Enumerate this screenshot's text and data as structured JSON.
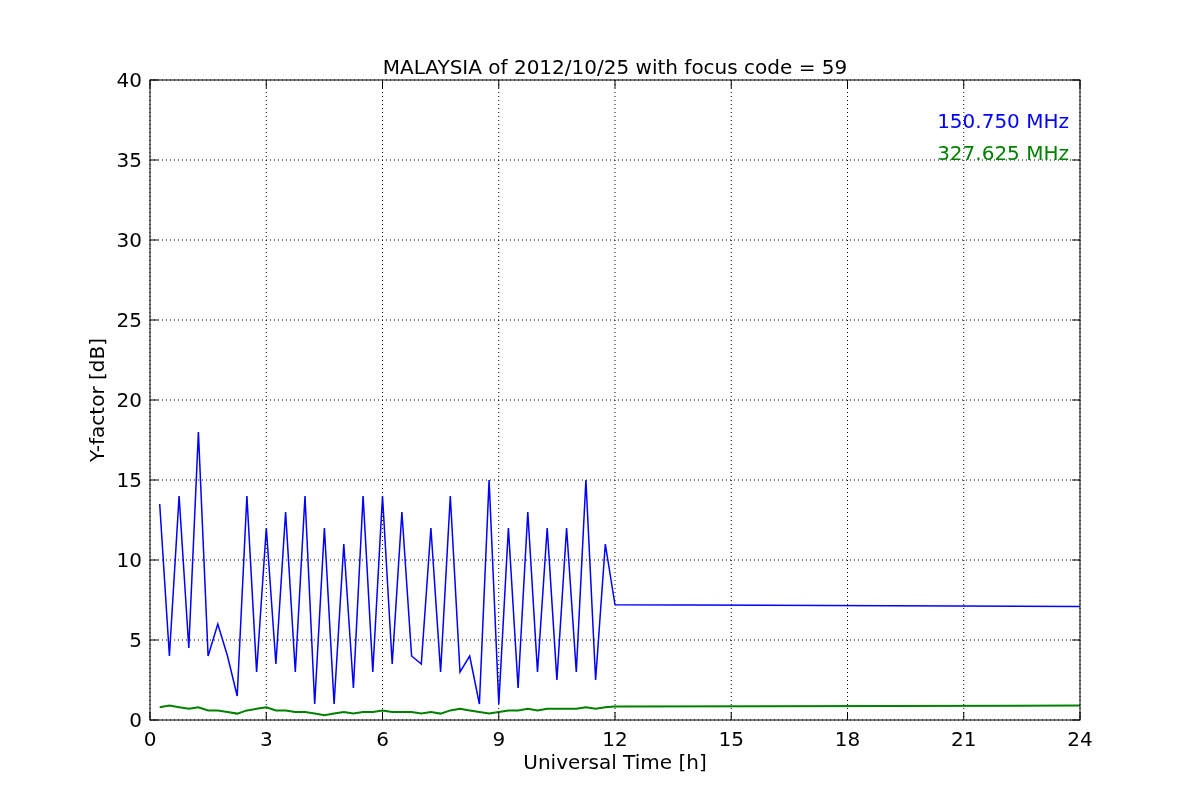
{
  "chart_data": {
    "type": "line",
    "title": "MALAYSIA of 2012/10/25 with focus code = 59",
    "xlabel": "Universal Time [h]",
    "ylabel": "Y-factor [dB]",
    "x": [
      0.25,
      0.5,
      0.75,
      1.0,
      1.25,
      1.5,
      1.75,
      2.0,
      2.25,
      2.5,
      2.75,
      3.0,
      3.25,
      3.5,
      3.75,
      4.0,
      4.25,
      4.5,
      4.75,
      5.0,
      5.25,
      5.5,
      5.75,
      6.0,
      6.25,
      6.5,
      6.75,
      7.0,
      7.25,
      7.5,
      7.75,
      8.0,
      8.25,
      8.5,
      8.75,
      9.0,
      9.25,
      9.5,
      9.75,
      10.0,
      10.25,
      10.5,
      10.75,
      11.0,
      11.25,
      11.5,
      11.75,
      12.0,
      24.0
    ],
    "series": [
      {
        "name": "150.750 MHz",
        "color": "#0000ff",
        "values": [
          13.5,
          4,
          14,
          4.5,
          18,
          4,
          6,
          4,
          1.5,
          14,
          3,
          12,
          3.5,
          13,
          3,
          14,
          1,
          12,
          1,
          11,
          2,
          14,
          3,
          14,
          3.5,
          13,
          4,
          3.5,
          12,
          3,
          14,
          3,
          4,
          1,
          15,
          1,
          12,
          2,
          13,
          3,
          12,
          2.5,
          12,
          3,
          15,
          2.5,
          11,
          7.2,
          7.1
        ]
      },
      {
        "name": "327.625 MHz",
        "color": "#008000",
        "values": [
          0.8,
          0.9,
          0.8,
          0.7,
          0.8,
          0.6,
          0.6,
          0.5,
          0.4,
          0.6,
          0.7,
          0.8,
          0.6,
          0.6,
          0.5,
          0.5,
          0.4,
          0.3,
          0.4,
          0.5,
          0.4,
          0.5,
          0.5,
          0.6,
          0.5,
          0.5,
          0.5,
          0.4,
          0.5,
          0.4,
          0.6,
          0.7,
          0.6,
          0.5,
          0.4,
          0.5,
          0.6,
          0.6,
          0.7,
          0.6,
          0.7,
          0.7,
          0.7,
          0.7,
          0.8,
          0.7,
          0.8,
          0.85,
          0.9
        ]
      }
    ],
    "xlim": [
      0,
      24
    ],
    "ylim": [
      0,
      40
    ],
    "xticks": [
      0,
      3,
      6,
      9,
      12,
      15,
      18,
      21,
      24
    ],
    "yticks": [
      0,
      5,
      10,
      15,
      20,
      25,
      30,
      35,
      40
    ],
    "grid": true
  }
}
